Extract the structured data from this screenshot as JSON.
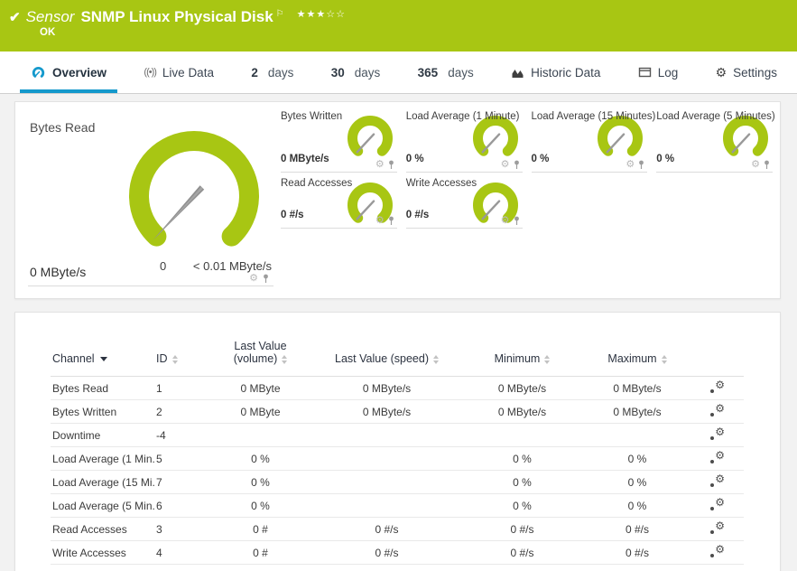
{
  "colors": {
    "brand_green": "#a8c613",
    "accent_blue": "#1499cc",
    "needle_gray": "#8f8f8f"
  },
  "icons": {
    "check": "✔",
    "flag": "⚐",
    "stars": "★★★☆☆",
    "gear": "⚙",
    "live": "((•))"
  },
  "header": {
    "kind": "Sensor",
    "title": "SNMP Linux Physical Disk",
    "status": "OK"
  },
  "tabs": [
    {
      "label": "Overview"
    },
    {
      "label": "Live Data"
    },
    {
      "num": "2",
      "unit": "days"
    },
    {
      "num": "30",
      "unit": "days"
    },
    {
      "num": "365",
      "unit": "days"
    },
    {
      "label": "Historic Data"
    },
    {
      "label": "Log"
    },
    {
      "label": "Settings"
    }
  ],
  "gauges": {
    "primary": {
      "title": "Bytes Read",
      "value": "0 MByte/s",
      "scale_start": "0",
      "scale_end": "< 0.01 MByte/s"
    },
    "small": [
      {
        "title": "Bytes Written",
        "value": "0 MByte/s"
      },
      {
        "title": "Load Average (1 Minute)",
        "value": "0 %"
      },
      {
        "title": "Load Average (15 Minutes)",
        "value": "0 %"
      },
      {
        "title": "Load Average (5 Minutes)",
        "value": "0 %"
      },
      {
        "title": "Read Accesses",
        "value": "0 #/s"
      },
      {
        "title": "Write Accesses",
        "value": "0 #/s"
      }
    ]
  },
  "table": {
    "columns": {
      "channel": "Channel",
      "id": "ID",
      "last_value_volume_line1": "Last Value",
      "last_value_volume_line2": "(volume)",
      "last_value_speed": "Last Value (speed)",
      "minimum": "Minimum",
      "maximum": "Maximum"
    },
    "rows": [
      {
        "channel": "Bytes Read",
        "id": "1",
        "vol": "0 MByte",
        "speed": "0 MByte/s",
        "min": "0 MByte/s",
        "max": "0 MByte/s"
      },
      {
        "channel": "Bytes Written",
        "id": "2",
        "vol": "0 MByte",
        "speed": "0 MByte/s",
        "min": "0 MByte/s",
        "max": "0 MByte/s"
      },
      {
        "channel": "Downtime",
        "id": "-4",
        "vol": "",
        "speed": "",
        "min": "",
        "max": ""
      },
      {
        "channel": "Load Average (1 Min...",
        "id": "5",
        "vol": "0 %",
        "speed": "",
        "min": "0 %",
        "max": "0 %"
      },
      {
        "channel": "Load Average (15 Mi...",
        "id": "7",
        "vol": "0 %",
        "speed": "",
        "min": "0 %",
        "max": "0 %"
      },
      {
        "channel": "Load Average (5 Min...",
        "id": "6",
        "vol": "0 %",
        "speed": "",
        "min": "0 %",
        "max": "0 %"
      },
      {
        "channel": "Read Accesses",
        "id": "3",
        "vol": "0 #",
        "speed": "0 #/s",
        "min": "0 #/s",
        "max": "0 #/s"
      },
      {
        "channel": "Write Accesses",
        "id": "4",
        "vol": "0 #",
        "speed": "0 #/s",
        "min": "0 #/s",
        "max": "0 #/s"
      }
    ]
  }
}
